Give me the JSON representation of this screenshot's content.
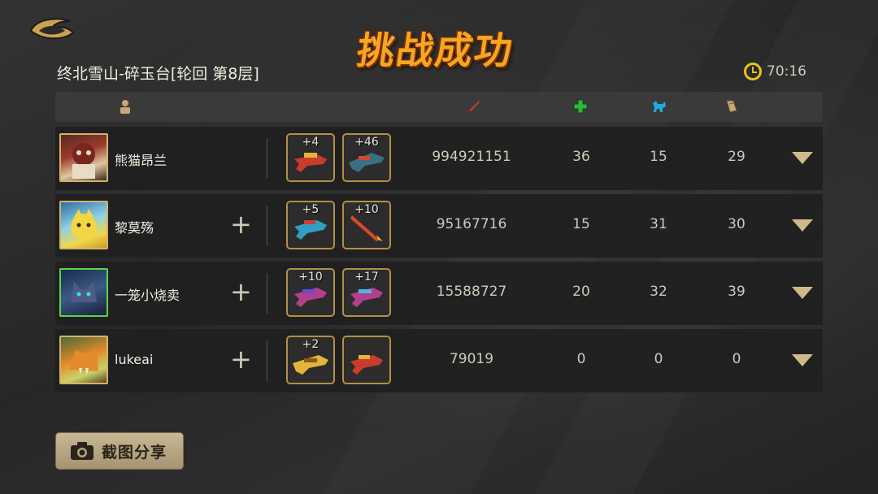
{
  "header": {
    "title": "挑战成功",
    "stage": "终北雪山-碎玉台[轮回 第8层]",
    "timer": "70:16"
  },
  "columns": {
    "player_icon": "person-icon",
    "damage_icon": "red-sword-icon",
    "heal_icon": "green-cross-icon",
    "pet_icon": "blue-fox-icon",
    "scroll_icon": "scroll-icon"
  },
  "players": [
    {
      "name": "熊猫昂兰",
      "weapon1_level": "+4",
      "weapon2_level": "+46",
      "damage": "994921151",
      "heal": "36",
      "pet": "15",
      "scroll": "29",
      "show_add": false
    },
    {
      "name": "黎莫殇",
      "weapon1_level": "+5",
      "weapon2_level": "+10",
      "damage": "95167716",
      "heal": "15",
      "pet": "31",
      "scroll": "30",
      "show_add": true
    },
    {
      "name": "一笼小烧卖",
      "weapon1_level": "+10",
      "weapon2_level": "+17",
      "damage": "15588727",
      "heal": "20",
      "pet": "32",
      "scroll": "39",
      "show_add": true
    },
    {
      "name": "lukeai",
      "weapon1_level": "+2",
      "weapon2_level": "",
      "damage": "79019",
      "heal": "0",
      "pet": "0",
      "scroll": "0",
      "show_add": true
    }
  ],
  "actions": {
    "share_label": "截图分享"
  },
  "colors": {
    "accent_gold": "#d4b26a",
    "title_orange": "#f5a623",
    "timer_yellow": "#e7c21d"
  }
}
